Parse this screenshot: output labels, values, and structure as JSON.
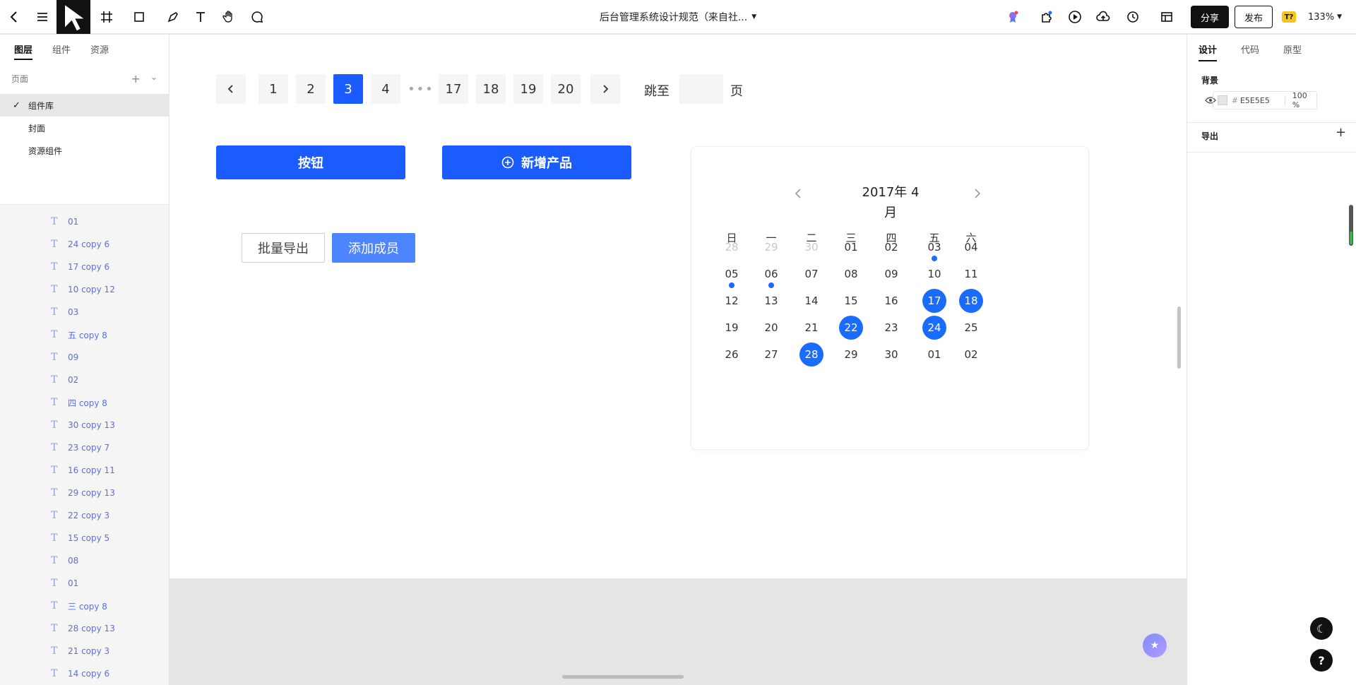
{
  "app": {
    "title": "后台管理系统设计规范（来自社...",
    "share_label": "分享",
    "publish_label": "发布",
    "badge": "T?",
    "zoom": "133%"
  },
  "left_panel": {
    "tabs": [
      "图层",
      "组件",
      "资源"
    ],
    "pages_header": "页面",
    "pages": [
      "组件库",
      "封面",
      "资源组件"
    ],
    "layers": [
      "01",
      "24 copy 6",
      "17 copy 6",
      "10 copy 12",
      "03",
      "五 copy 8",
      "09",
      "02",
      "四 copy 8",
      "30 copy 13",
      "23 copy 7",
      "16 copy 11",
      "29 copy 13",
      "22 copy 3",
      "15 copy 5",
      "08",
      "01",
      "三 copy 8",
      "28 copy 13",
      "21 copy 3",
      "14 copy 6"
    ]
  },
  "pagination": {
    "pages": [
      "1",
      "2",
      "3",
      "4",
      "17",
      "18",
      "19",
      "20"
    ],
    "active": "3",
    "jump_label": "跳至",
    "page_suffix": "页"
  },
  "buttons": {
    "button_label": "按钮",
    "add_product_label": "新增产品",
    "batch_export_label": "批量导出",
    "add_member_label": "添加成员"
  },
  "calendar": {
    "title": "2017年 4 月",
    "weekdays": [
      "日",
      "一",
      "二",
      "三",
      "四",
      "五",
      "六"
    ],
    "rows": [
      [
        "28",
        "29",
        "30",
        "01",
        "02",
        "03",
        "04"
      ],
      [
        "05",
        "06",
        "07",
        "08",
        "09",
        "10",
        "11"
      ],
      [
        "12",
        "13",
        "14",
        "15",
        "16",
        "17",
        "18"
      ],
      [
        "19",
        "20",
        "21",
        "22",
        "23",
        "24",
        "25"
      ],
      [
        "26",
        "27",
        "28",
        "29",
        "30",
        "01",
        "02"
      ]
    ],
    "accent": "#1a6cff"
  },
  "right_panel": {
    "tabs": [
      "设计",
      "代码",
      "原型"
    ],
    "background_title": "背景",
    "background_hex": "E5E5E5",
    "background_opacity": "100 %",
    "export_title": "导出"
  }
}
